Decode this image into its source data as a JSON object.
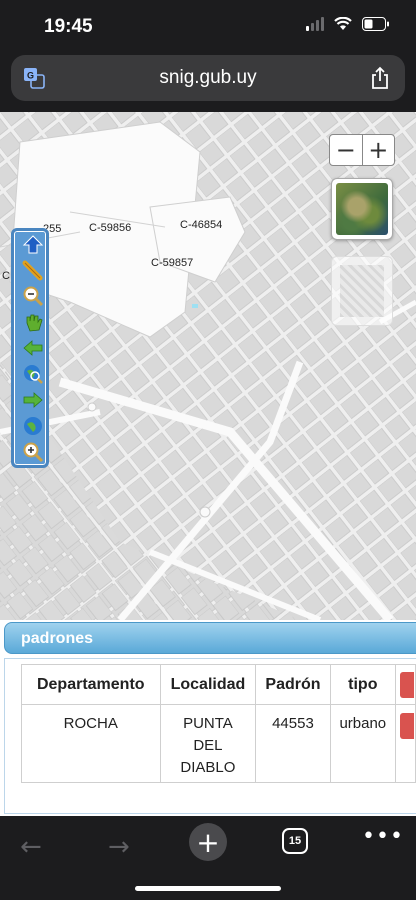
{
  "status_bar": {
    "time": "19:45"
  },
  "browser": {
    "url": "snig.gub.uy",
    "tab_count": "15"
  },
  "map": {
    "parcel_labels": [
      "C-59856",
      "C-46854",
      "C-59857",
      "255",
      "C"
    ],
    "zoom_out_label": "−",
    "zoom_in_label": "+"
  },
  "panel": {
    "title": "padrones",
    "table": {
      "headers": [
        "Departamento",
        "Localidad",
        "Padrón",
        "tipo"
      ],
      "rows": [
        {
          "departamento": "ROCHA",
          "localidad_1": "PUNTA",
          "localidad_2": "DEL",
          "localidad_3": "DIABLO",
          "padron": "44553",
          "tipo": "urbano"
        }
      ]
    }
  },
  "colors": {
    "toolbar": "#5b9ad4",
    "panel_header": "#5aa9d8",
    "action_button": "#d9534f"
  }
}
